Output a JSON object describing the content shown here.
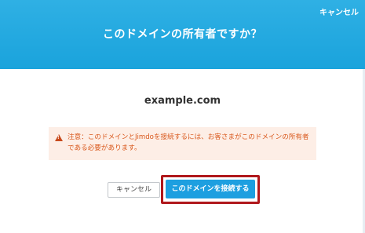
{
  "header": {
    "cancel_label": "キャンセル",
    "title": "このドメインの所有者ですか？"
  },
  "content": {
    "domain": "example.com",
    "warning": {
      "icon": "warning-icon",
      "text": "注意：このドメインとJimdoを接続するには、お客さまがこのドメインの所有者である必要があります。"
    }
  },
  "actions": {
    "cancel_label": "キャンセル",
    "connect_label": "このドメインを接続する"
  },
  "colors": {
    "header_blue": "#1aa3dc",
    "warning_bg": "#fdeee6",
    "warning_text": "#d9581c",
    "primary_button": "#1d9fe0",
    "highlight_frame": "#b0181c"
  }
}
